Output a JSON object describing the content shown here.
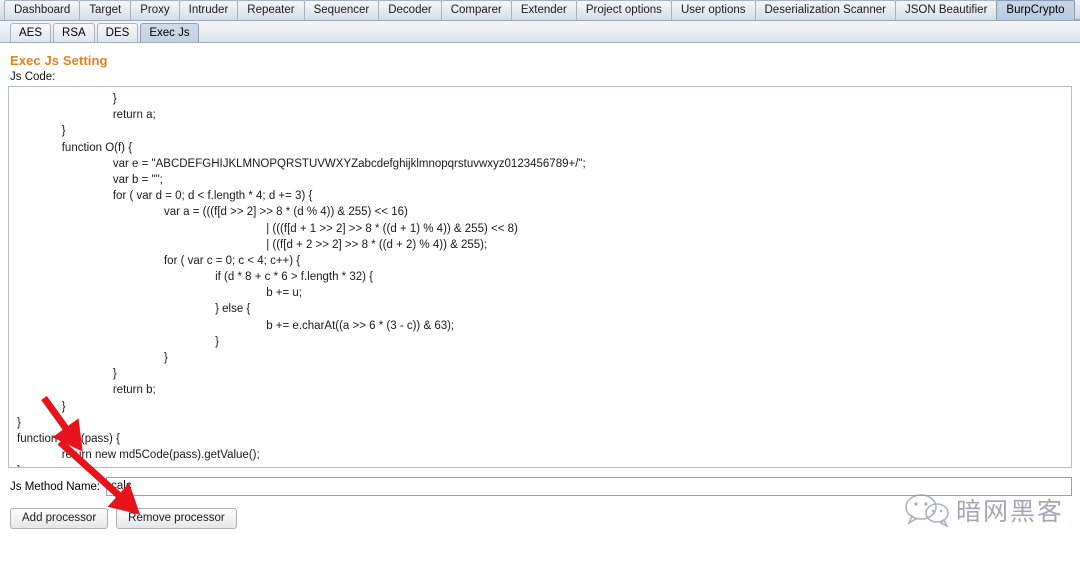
{
  "main_tabs": [
    {
      "label": "Dashboard",
      "active": false
    },
    {
      "label": "Target",
      "active": false
    },
    {
      "label": "Proxy",
      "active": false
    },
    {
      "label": "Intruder",
      "active": false
    },
    {
      "label": "Repeater",
      "active": false
    },
    {
      "label": "Sequencer",
      "active": false
    },
    {
      "label": "Decoder",
      "active": false
    },
    {
      "label": "Comparer",
      "active": false
    },
    {
      "label": "Extender",
      "active": false
    },
    {
      "label": "Project options",
      "active": false
    },
    {
      "label": "User options",
      "active": false
    },
    {
      "label": "Deserialization Scanner",
      "active": false
    },
    {
      "label": "JSON Beautifier",
      "active": false
    },
    {
      "label": "BurpCrypto",
      "active": true
    }
  ],
  "sub_tabs": [
    {
      "label": "AES",
      "active": false
    },
    {
      "label": "RSA",
      "active": false
    },
    {
      "label": "DES",
      "active": false
    },
    {
      "label": "Exec Js",
      "active": true
    }
  ],
  "panel": {
    "section_title": "Exec Js Setting",
    "code_label": "Js Code:",
    "method_label": "Js Method Name:",
    "method_value": "calc",
    "method_placeholder": ""
  },
  "code_lines": [
    "                              }",
    "                              return a;",
    "              }",
    "              function O(f) {",
    "                              var e = \"ABCDEFGHIJKLMNOPQRSTUVWXYZabcdefghijklmnopqrstuvwxyz0123456789+/\";",
    "                              var b = \"\";",
    "                              for ( var d = 0; d < f.length * 4; d += 3) {",
    "                                              var a = (((f[d >> 2] >> 8 * (d % 4)) & 255) << 16)",
    "                                                                              | (((f[d + 1 >> 2] >> 8 * ((d + 1) % 4)) & 255) << 8)",
    "                                                                              | ((f[d + 2 >> 2] >> 8 * ((d + 2) % 4)) & 255);",
    "                                              for ( var c = 0; c < 4; c++) {",
    "                                                              if (d * 8 + c * 6 > f.length * 32) {",
    "                                                                              b += u;",
    "                                                              } else {",
    "                                                                              b += e.charAt((a >> 6 * (3 - c)) & 63);",
    "                                                              }",
    "                                              }",
    "                              }",
    "                              return b;",
    "              }",
    "}",
    "function calc(pass) {",
    "              return new md5Code(pass).getValue();",
    "}"
  ],
  "buttons": {
    "add": "Add processor",
    "remove": "Remove processor"
  },
  "annotations": {
    "arrow_color": "#e8131a",
    "arrow_1_target": "function calc(pass)",
    "arrow_2_target": "Js Method Name input"
  },
  "watermark": {
    "text": "暗网黑客",
    "icon": "wechat-icon",
    "color": "#7d8796"
  }
}
